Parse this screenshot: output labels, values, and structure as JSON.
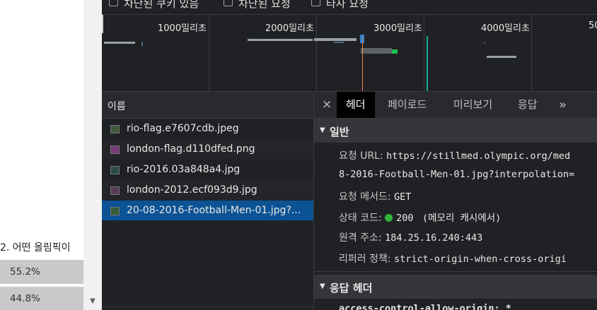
{
  "webpage": {
    "question": "2. 어떤 올림픽이",
    "options": [
      {
        "percent": "55.2%"
      },
      {
        "percent": "44.8%"
      }
    ]
  },
  "filters": {
    "blocked_cookies": "차단된 쿠키 있음",
    "blocked_requests": "차단된 요청",
    "third_party": "타사 요청"
  },
  "timeline": {
    "ticks": [
      "1000밀리초",
      "2000밀리초",
      "3000밀리초",
      "4000밀리초",
      "50"
    ]
  },
  "request_list": {
    "header": "이름",
    "items": [
      {
        "name": "rio-flag.e7607cdb.jpeg"
      },
      {
        "name": "london-flag.d110dfed.png"
      },
      {
        "name": "rio-2016.03a848a4.jpg"
      },
      {
        "name": "london-2012.ecf093d9.jpg"
      },
      {
        "name": "20-08-2016-Football-Men-01.jpg?..."
      }
    ]
  },
  "detail_tabs": {
    "close": "×",
    "headers": "헤더",
    "payload": "페이로드",
    "preview": "미리보기",
    "response": "응답",
    "more": "»"
  },
  "general": {
    "title": "일반",
    "request_url_key": "요청 URL:",
    "request_url_value": "https://stillmed.olympic.org/med",
    "request_url_value_2": "8-2016-Football-Men-01.jpg?interpolation=",
    "method_key": "요청 메서드:",
    "method_value": "GET",
    "status_key": "상태 코드:",
    "status_value": "200",
    "status_note": "(메모리 캐시에서)",
    "remote_key": "원격 주소:",
    "remote_value": "184.25.16.240:443",
    "referrer_key": "리퍼러 정책:",
    "referrer_value": "strict-origin-when-cross-origi"
  },
  "response_headers": {
    "title": "응답 헤더",
    "first_row": "access-control-allow-origin: *"
  },
  "colors": {
    "selected": "#0b5394",
    "status_ok": "#2fb53c",
    "timeline_marker": "#e8804a",
    "timeline_teal": "#1aa39a"
  }
}
